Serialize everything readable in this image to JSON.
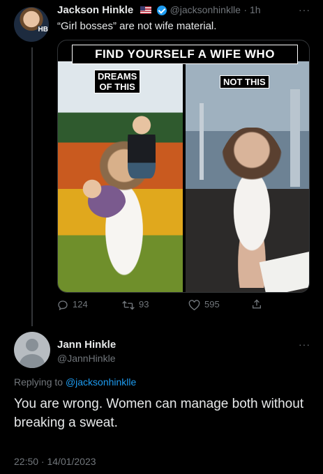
{
  "tweet": {
    "author_name": "Jackson Hinkle",
    "handle": "@jacksonhinklle",
    "time": "· 1h",
    "avatar_tag": "HB",
    "text": "“Girl bosses” are not wife material.",
    "more_icon": "more-dots-icon",
    "media": {
      "banner": "FIND YOURSELF A WIFE WHO",
      "left_label": "DREAMS\nOF THIS",
      "right_label": "NOT THIS"
    },
    "actions": {
      "replies": "124",
      "retweets": "93",
      "likes": "595"
    }
  },
  "reply": {
    "author_name": "Jann Hinkle",
    "handle": "@JannHinkle",
    "replying_prefix": "Replying to ",
    "replying_handle": "@jacksonhinklle",
    "text": "You are wrong. Women can manage both without breaking a sweat.",
    "timestamp": "22:50 · 14/01/2023"
  },
  "colors": {
    "background": "#000000",
    "link": "#1d9bf0",
    "muted": "#71767b",
    "text": "#e7e9ea"
  }
}
